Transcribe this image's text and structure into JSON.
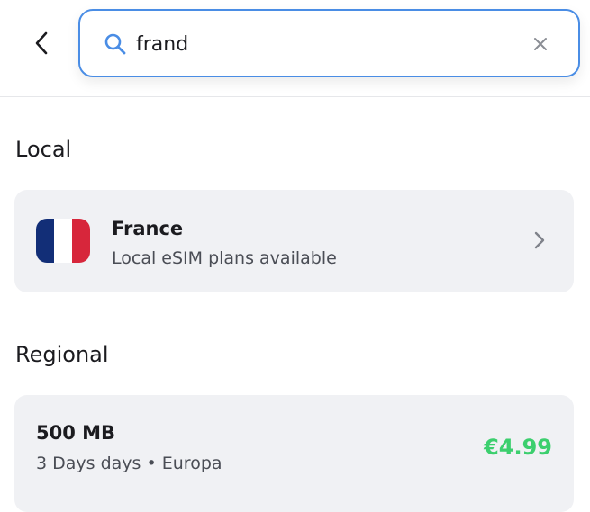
{
  "search": {
    "value": "frand",
    "placeholder": ""
  },
  "icons": {
    "back": "chevron-left-icon",
    "search": "search-icon",
    "clear": "close-icon",
    "row_chevron": "chevron-right-icon"
  },
  "sections": {
    "local": {
      "title": "Local",
      "items": [
        {
          "name": "France",
          "subtitle": "Local eSIM plans available",
          "flag": "france-flag"
        }
      ]
    },
    "regional": {
      "title": "Regional",
      "items": [
        {
          "size": "500 MB",
          "duration": "3 Days days",
          "separator": "•",
          "region": "Europa",
          "price": "€4.99"
        }
      ]
    }
  },
  "colors": {
    "accent": "#4a8de5",
    "price": "#3ccf6e",
    "card_bg": "#f0f1f4",
    "spellcheck": "#e0383e"
  }
}
